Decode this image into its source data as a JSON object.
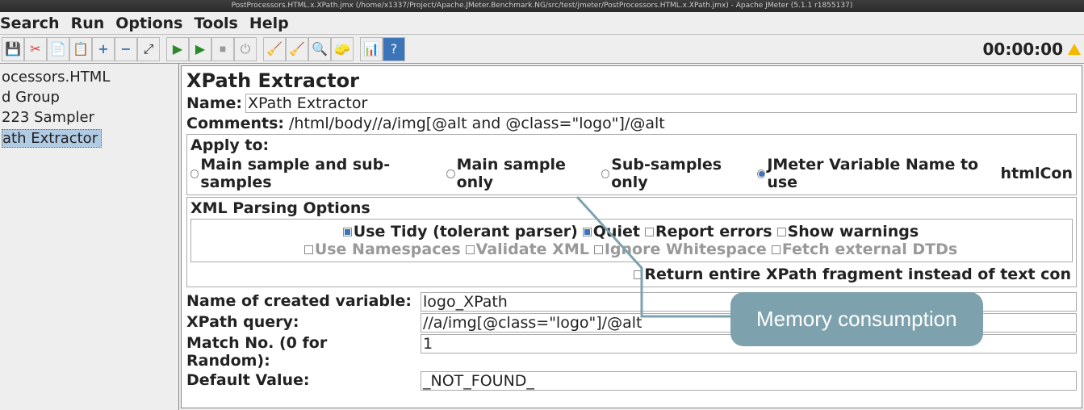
{
  "window": {
    "title": "PostProcessors.HTML.x.XPath.jmx (/home/x1337/Project/Apache.JMeter.Benchmark.NG/src/test/jmeter/PostProcessors.HTML.x.XPath.jmx) - Apache JMeter (5.1.1 r1855137)"
  },
  "menu": {
    "search": "Search",
    "run": "Run",
    "options": "Options",
    "tools": "Tools",
    "help": "Help"
  },
  "toolbar": {
    "timer": "00:00:00"
  },
  "tree": {
    "items": [
      "ocessors.HTML",
      "d Group",
      "223 Sampler",
      "ath Extractor"
    ],
    "selected_index": 3
  },
  "panel": {
    "title": "XPath Extractor",
    "name_label": "Name:",
    "name_value": "XPath Extractor",
    "comments_label": "Comments:",
    "comments_value": "/html/body//a/img[@alt and @class=\"logo\"]/@alt",
    "apply_label": "Apply to:",
    "apply_options": {
      "o1": "Main sample and sub-samples",
      "o2": "Main sample only",
      "o3": "Sub-samples only",
      "o4": "JMeter Variable Name to use"
    },
    "jmeter_var_value": "htmlCon",
    "xml_options_label": "XML Parsing Options",
    "checks": {
      "tidy": "Use Tidy (tolerant parser)",
      "quiet": "Quiet",
      "report": "Report errors",
      "warn": "Show warnings",
      "ns": "Use Namespaces",
      "validate": "Validate XML",
      "ignorews": "Ignore Whitespace",
      "dtd": "Fetch external DTDs",
      "frag": "Return entire XPath fragment instead of text con"
    },
    "form": {
      "varname_label": "Name of created variable:",
      "varname_value": "logo_XPath",
      "xpath_label": "XPath query:",
      "xpath_value": "//a/img[@class=\"logo\"]/@alt",
      "matchno_label": "Match No. (0 for Random):",
      "matchno_value": "1",
      "default_label": "Default Value:",
      "default_value": "_NOT_FOUND_"
    }
  },
  "callout": {
    "text": "Memory consumption"
  }
}
